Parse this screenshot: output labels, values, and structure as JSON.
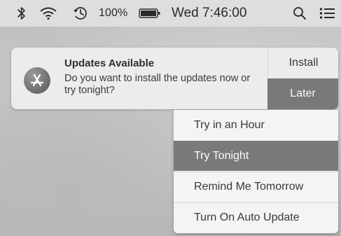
{
  "menubar": {
    "battery_percent": "100%",
    "clock": "Wed 7:46:00",
    "icons": [
      "bluetooth-icon",
      "wifi-icon",
      "time-machine-icon",
      "battery-icon",
      "spotlight-search-icon",
      "notification-center-icon"
    ]
  },
  "notification": {
    "title": "Updates Available",
    "body": "Do you want to install the updates now or try tonight?",
    "install_label": "Install",
    "later_label": "Later",
    "app_icon": "app-store-icon"
  },
  "later_menu": {
    "items": [
      {
        "label": "Try in an Hour"
      },
      {
        "label": "Try Tonight"
      },
      {
        "label": "Remind Me Tomorrow"
      },
      {
        "label": "Turn On Auto Update"
      }
    ]
  }
}
